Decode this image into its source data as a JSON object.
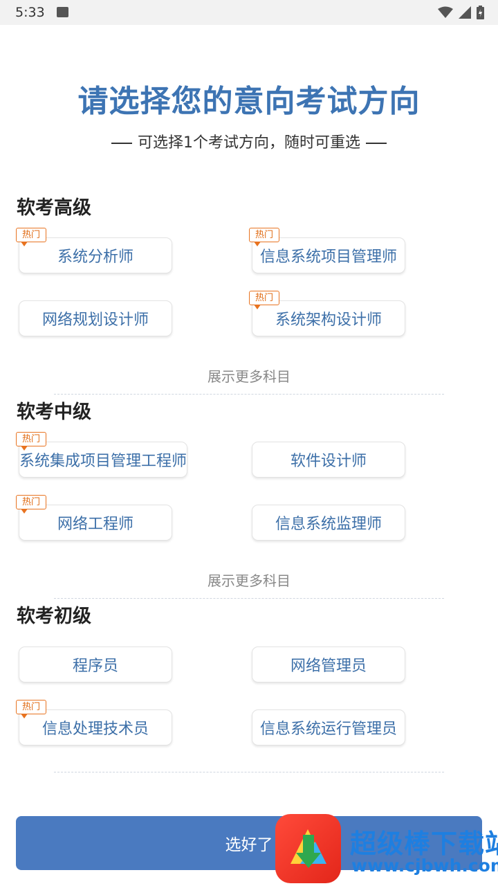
{
  "status_bar": {
    "time": "5:33"
  },
  "header": {
    "title": "请选择您的意向考试方向",
    "subtitle": "可选择1个考试方向，随时可重选"
  },
  "hot_label": "热门",
  "sections": [
    {
      "title": "软考高级",
      "options": [
        "系统分析师",
        "信息系统项目管理师",
        "网络规划设计师",
        "系统架构设计师"
      ],
      "show_more": "展示更多科目"
    },
    {
      "title": "软考中级",
      "options": [
        "系统集成项目管理工程师",
        "软件设计师",
        "网络工程师",
        "信息系统监理师"
      ],
      "show_more": "展示更多科目"
    },
    {
      "title": "软考初级",
      "options": [
        "程序员",
        "网络管理员",
        "信息处理技术员",
        "信息系统运行管理员"
      ]
    }
  ],
  "confirm_button": "选好了",
  "watermark": {
    "name": "超级棒下载站",
    "url": "www.cjbwh.com"
  },
  "colors": {
    "accent": "#3d74b3",
    "button": "#4a7ac0",
    "hot": "#e87320"
  }
}
